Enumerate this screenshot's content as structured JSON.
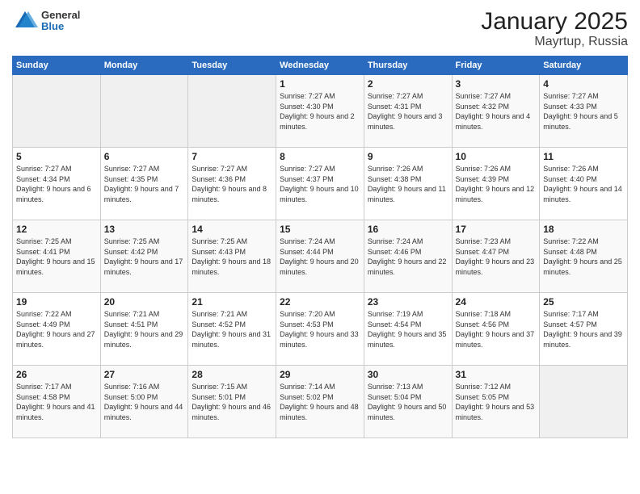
{
  "header": {
    "logo_general": "General",
    "logo_blue": "Blue",
    "title": "January 2025",
    "subtitle": "Mayrtup, Russia"
  },
  "weekdays": [
    "Sunday",
    "Monday",
    "Tuesday",
    "Wednesday",
    "Thursday",
    "Friday",
    "Saturday"
  ],
  "weeks": [
    [
      {
        "day": "",
        "info": ""
      },
      {
        "day": "",
        "info": ""
      },
      {
        "day": "",
        "info": ""
      },
      {
        "day": "1",
        "info": "Sunrise: 7:27 AM\nSunset: 4:30 PM\nDaylight: 9 hours and 2 minutes."
      },
      {
        "day": "2",
        "info": "Sunrise: 7:27 AM\nSunset: 4:31 PM\nDaylight: 9 hours and 3 minutes."
      },
      {
        "day": "3",
        "info": "Sunrise: 7:27 AM\nSunset: 4:32 PM\nDaylight: 9 hours and 4 minutes."
      },
      {
        "day": "4",
        "info": "Sunrise: 7:27 AM\nSunset: 4:33 PM\nDaylight: 9 hours and 5 minutes."
      }
    ],
    [
      {
        "day": "5",
        "info": "Sunrise: 7:27 AM\nSunset: 4:34 PM\nDaylight: 9 hours and 6 minutes."
      },
      {
        "day": "6",
        "info": "Sunrise: 7:27 AM\nSunset: 4:35 PM\nDaylight: 9 hours and 7 minutes."
      },
      {
        "day": "7",
        "info": "Sunrise: 7:27 AM\nSunset: 4:36 PM\nDaylight: 9 hours and 8 minutes."
      },
      {
        "day": "8",
        "info": "Sunrise: 7:27 AM\nSunset: 4:37 PM\nDaylight: 9 hours and 10 minutes."
      },
      {
        "day": "9",
        "info": "Sunrise: 7:26 AM\nSunset: 4:38 PM\nDaylight: 9 hours and 11 minutes."
      },
      {
        "day": "10",
        "info": "Sunrise: 7:26 AM\nSunset: 4:39 PM\nDaylight: 9 hours and 12 minutes."
      },
      {
        "day": "11",
        "info": "Sunrise: 7:26 AM\nSunset: 4:40 PM\nDaylight: 9 hours and 14 minutes."
      }
    ],
    [
      {
        "day": "12",
        "info": "Sunrise: 7:25 AM\nSunset: 4:41 PM\nDaylight: 9 hours and 15 minutes."
      },
      {
        "day": "13",
        "info": "Sunrise: 7:25 AM\nSunset: 4:42 PM\nDaylight: 9 hours and 17 minutes."
      },
      {
        "day": "14",
        "info": "Sunrise: 7:25 AM\nSunset: 4:43 PM\nDaylight: 9 hours and 18 minutes."
      },
      {
        "day": "15",
        "info": "Sunrise: 7:24 AM\nSunset: 4:44 PM\nDaylight: 9 hours and 20 minutes."
      },
      {
        "day": "16",
        "info": "Sunrise: 7:24 AM\nSunset: 4:46 PM\nDaylight: 9 hours and 22 minutes."
      },
      {
        "day": "17",
        "info": "Sunrise: 7:23 AM\nSunset: 4:47 PM\nDaylight: 9 hours and 23 minutes."
      },
      {
        "day": "18",
        "info": "Sunrise: 7:22 AM\nSunset: 4:48 PM\nDaylight: 9 hours and 25 minutes."
      }
    ],
    [
      {
        "day": "19",
        "info": "Sunrise: 7:22 AM\nSunset: 4:49 PM\nDaylight: 9 hours and 27 minutes."
      },
      {
        "day": "20",
        "info": "Sunrise: 7:21 AM\nSunset: 4:51 PM\nDaylight: 9 hours and 29 minutes."
      },
      {
        "day": "21",
        "info": "Sunrise: 7:21 AM\nSunset: 4:52 PM\nDaylight: 9 hours and 31 minutes."
      },
      {
        "day": "22",
        "info": "Sunrise: 7:20 AM\nSunset: 4:53 PM\nDaylight: 9 hours and 33 minutes."
      },
      {
        "day": "23",
        "info": "Sunrise: 7:19 AM\nSunset: 4:54 PM\nDaylight: 9 hours and 35 minutes."
      },
      {
        "day": "24",
        "info": "Sunrise: 7:18 AM\nSunset: 4:56 PM\nDaylight: 9 hours and 37 minutes."
      },
      {
        "day": "25",
        "info": "Sunrise: 7:17 AM\nSunset: 4:57 PM\nDaylight: 9 hours and 39 minutes."
      }
    ],
    [
      {
        "day": "26",
        "info": "Sunrise: 7:17 AM\nSunset: 4:58 PM\nDaylight: 9 hours and 41 minutes."
      },
      {
        "day": "27",
        "info": "Sunrise: 7:16 AM\nSunset: 5:00 PM\nDaylight: 9 hours and 44 minutes."
      },
      {
        "day": "28",
        "info": "Sunrise: 7:15 AM\nSunset: 5:01 PM\nDaylight: 9 hours and 46 minutes."
      },
      {
        "day": "29",
        "info": "Sunrise: 7:14 AM\nSunset: 5:02 PM\nDaylight: 9 hours and 48 minutes."
      },
      {
        "day": "30",
        "info": "Sunrise: 7:13 AM\nSunset: 5:04 PM\nDaylight: 9 hours and 50 minutes."
      },
      {
        "day": "31",
        "info": "Sunrise: 7:12 AM\nSunset: 5:05 PM\nDaylight: 9 hours and 53 minutes."
      },
      {
        "day": "",
        "info": ""
      }
    ]
  ]
}
